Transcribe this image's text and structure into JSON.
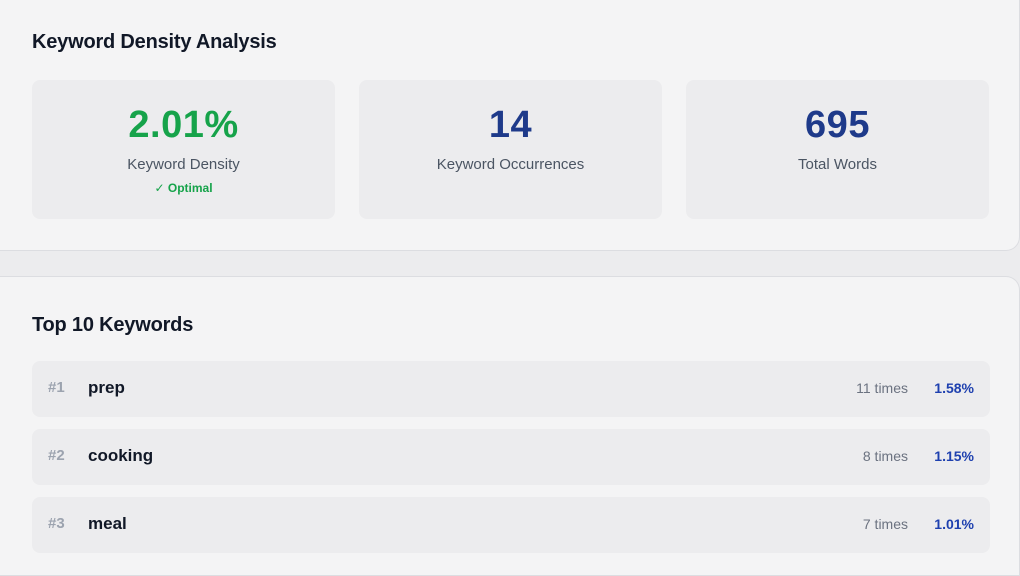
{
  "analysis": {
    "title": "Keyword Density Analysis",
    "stats": [
      {
        "value": "2.01%",
        "label": "Keyword Density",
        "note": "✓ Optimal"
      },
      {
        "value": "14",
        "label": "Keyword Occurrences"
      },
      {
        "value": "695",
        "label": "Total Words"
      }
    ]
  },
  "top_keywords": {
    "title": "Top 10 Keywords",
    "items": [
      {
        "rank": "#1",
        "word": "prep",
        "count": "11 times",
        "percent": "1.58%"
      },
      {
        "rank": "#2",
        "word": "cooking",
        "count": "8 times",
        "percent": "1.15%"
      },
      {
        "rank": "#3",
        "word": "meal",
        "count": "7 times",
        "percent": "1.01%"
      }
    ]
  },
  "colors": {
    "optimal_green": "#16a34a",
    "value_blue": "#1e3a8a",
    "percent_blue": "#1e40af"
  }
}
